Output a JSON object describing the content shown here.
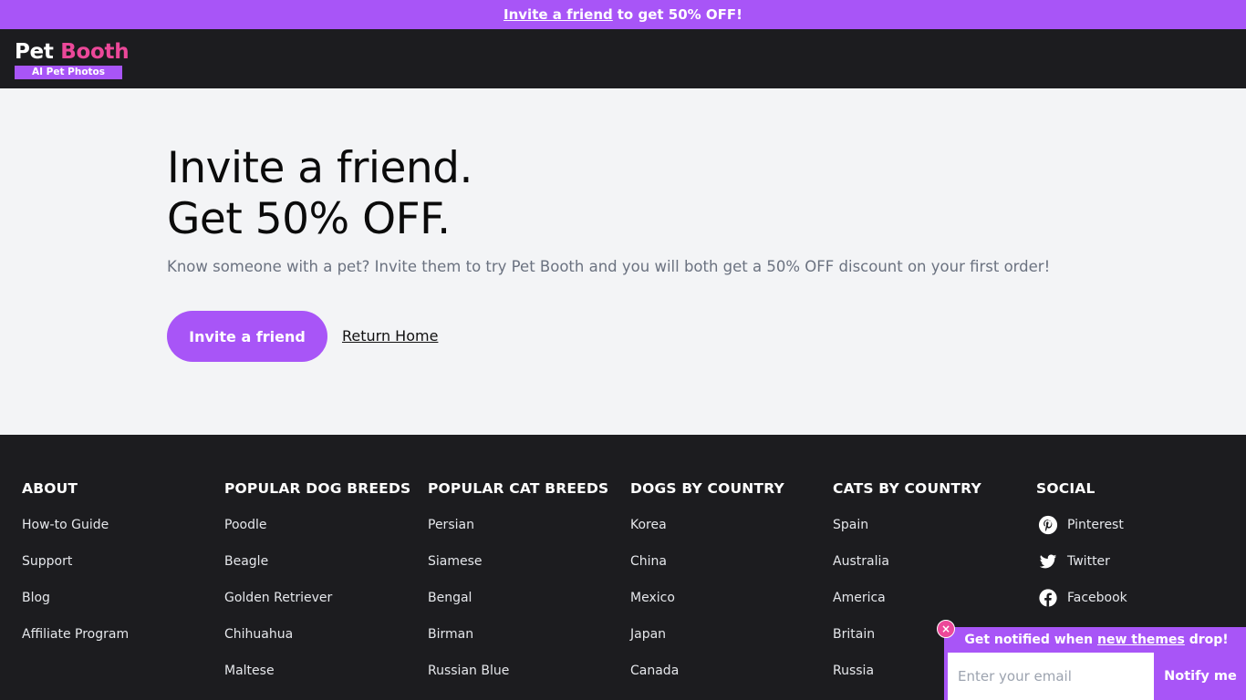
{
  "announcement": {
    "link_text": "Invite a friend",
    "rest_text": "to get 50% OFF!"
  },
  "logo": {
    "part1": "Pet",
    "part2": "Booth",
    "tagline": "AI Pet Photos"
  },
  "hero": {
    "title_line1": "Invite a friend.",
    "title_line2": "Get 50% OFF.",
    "subtitle": "Know someone with a pet? Invite them to try Pet Booth and you will both get a 50% OFF discount on your first order!",
    "invite_button": "Invite a friend",
    "home_link": "Return Home"
  },
  "footer": {
    "columns": [
      {
        "heading": "ABOUT",
        "items": [
          "How-to Guide",
          "Support",
          "Blog",
          "Affiliate Program"
        ]
      },
      {
        "heading": "POPULAR DOG BREEDS",
        "items": [
          "Poodle",
          "Beagle",
          "Golden Retriever",
          "Chihuahua",
          "Maltese"
        ]
      },
      {
        "heading": "POPULAR CAT BREEDS",
        "items": [
          "Persian",
          "Siamese",
          "Bengal",
          "Birman",
          "Russian Blue"
        ]
      },
      {
        "heading": "DOGS BY COUNTRY",
        "items": [
          "Korea",
          "China",
          "Mexico",
          "Japan",
          "Canada"
        ]
      },
      {
        "heading": "CATS BY COUNTRY",
        "items": [
          "Spain",
          "Australia",
          "America",
          "Britain",
          "Russia"
        ]
      },
      {
        "heading": "SOCIAL",
        "items": [
          {
            "label": "Pinterest",
            "icon": "pinterest-icon"
          },
          {
            "label": "Twitter",
            "icon": "twitter-icon"
          },
          {
            "label": "Facebook",
            "icon": "facebook-icon"
          }
        ]
      }
    ]
  },
  "notify": {
    "title_before": "Get notified when",
    "title_link": "new themes",
    "title_after": "drop!",
    "input_placeholder": "Enter your email",
    "button": "Notify me",
    "close": "×"
  },
  "colors": {
    "accent": "#a855f7",
    "brand_pink": "#ec4899",
    "dark_bg": "#1c1c1f",
    "hero_bg": "#f3f4f6"
  }
}
